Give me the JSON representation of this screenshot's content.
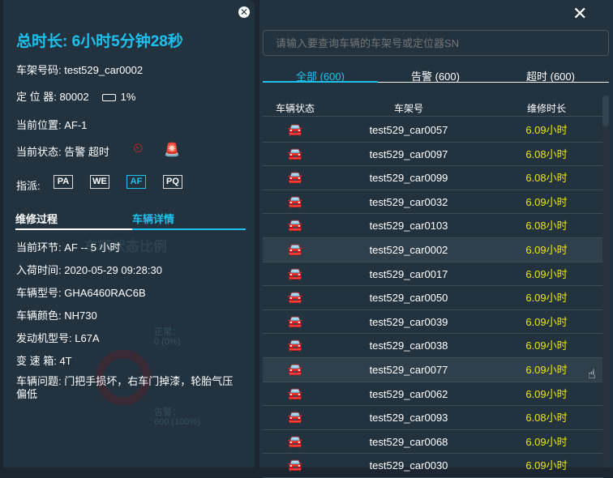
{
  "detail": {
    "title": "总时长: 6小时5分钟28秒",
    "frame": "车架号码: test529_car0002",
    "locator": "定 位 器: 80002",
    "battery": "1%",
    "position": "当前位置: AF-1",
    "status": "当前状态: 告警 超时",
    "assign_label": "指派:",
    "assign": [
      "PA",
      "WE",
      "AF",
      "PQ"
    ],
    "tabs": [
      "维修过程",
      "车辆详情"
    ],
    "fields": [
      "当前环节: AF -- 5 小时",
      "入荷时间: 2020-05-29 09:28:30",
      "车辆型号: GHA6460RAC6B",
      "车辆颜色: NH730",
      "发动机型号: L67A",
      "变 速 箱: 4T"
    ],
    "issue": "车辆问题: 门把手损坏，右车门掉漆，轮胎气压偏低",
    "bg_chart": {
      "title": "车辆状态比例",
      "normal_label": "正常：",
      "normal_value": "0 (0%)",
      "alarm_label": "告警：",
      "alarm_value": "600 (100%)"
    }
  },
  "list": {
    "search_placeholder": "请输入要查询车辆的车架号或定位器SN",
    "tabs": [
      "全部 (600)",
      "告警 (600)",
      "超时 (600)"
    ],
    "headers": [
      "车辆状态",
      "车架号",
      "维修时长"
    ],
    "rows": [
      [
        "test529_car0057",
        "6.09小时"
      ],
      [
        "test529_car0097",
        "6.08小时"
      ],
      [
        "test529_car0099",
        "6.08小时"
      ],
      [
        "test529_car0032",
        "6.09小时"
      ],
      [
        "test529_car0103",
        "6.08小时"
      ],
      [
        "test529_car0002",
        "6.09小时"
      ],
      [
        "test529_car0017",
        "6.09小时"
      ],
      [
        "test529_car0050",
        "6.09小时"
      ],
      [
        "test529_car0039",
        "6.09小时"
      ],
      [
        "test529_car0038",
        "6.09小时"
      ],
      [
        "test529_car0077",
        "6.09小时"
      ],
      [
        "test529_car0062",
        "6.09小时"
      ],
      [
        "test529_car0093",
        "6.08小时"
      ],
      [
        "test529_car0068",
        "6.09小时"
      ],
      [
        "test529_car0030",
        "6.09小时"
      ]
    ]
  },
  "colors": {
    "accent": "#1cc1ee",
    "alarm": "#e0261b",
    "duration": "#ece80c"
  }
}
